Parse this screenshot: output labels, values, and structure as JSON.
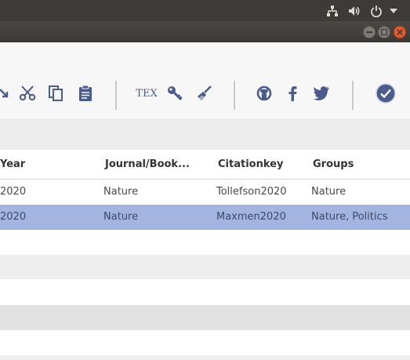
{
  "top_panel": {
    "icons": [
      "network-icon",
      "volume-icon",
      "power-icon",
      "dropdown-arrow-icon"
    ]
  },
  "window": {
    "buttons": [
      "minimize-button",
      "maximize-button",
      "close-button"
    ]
  },
  "toolbar": {
    "icons": [
      "import-arrow-icon",
      "scissors-icon",
      "copy-icon",
      "clipboard-icon",
      "tex-icon",
      "key-icon",
      "broom-icon",
      "github-icon",
      "facebook-icon",
      "twitter-icon",
      "check-circle-icon"
    ],
    "tex_label": "TEX"
  },
  "table": {
    "columns": [
      "Year",
      "Journal/Book...",
      "Citationkey",
      "Groups"
    ],
    "rows": [
      {
        "year": "2020",
        "journal": "Nature",
        "citationkey": "Tollefson2020",
        "groups": "Nature",
        "selected": false
      },
      {
        "year": "2020",
        "journal": "Nature",
        "citationkey": "Maxmen2020",
        "groups": "Nature, Politics",
        "selected": true
      }
    ]
  },
  "colors": {
    "accent": "#4a5b8e",
    "selection": "#a3b4e0",
    "panel": "#3c3b37",
    "close_button": "#e25a2c"
  }
}
